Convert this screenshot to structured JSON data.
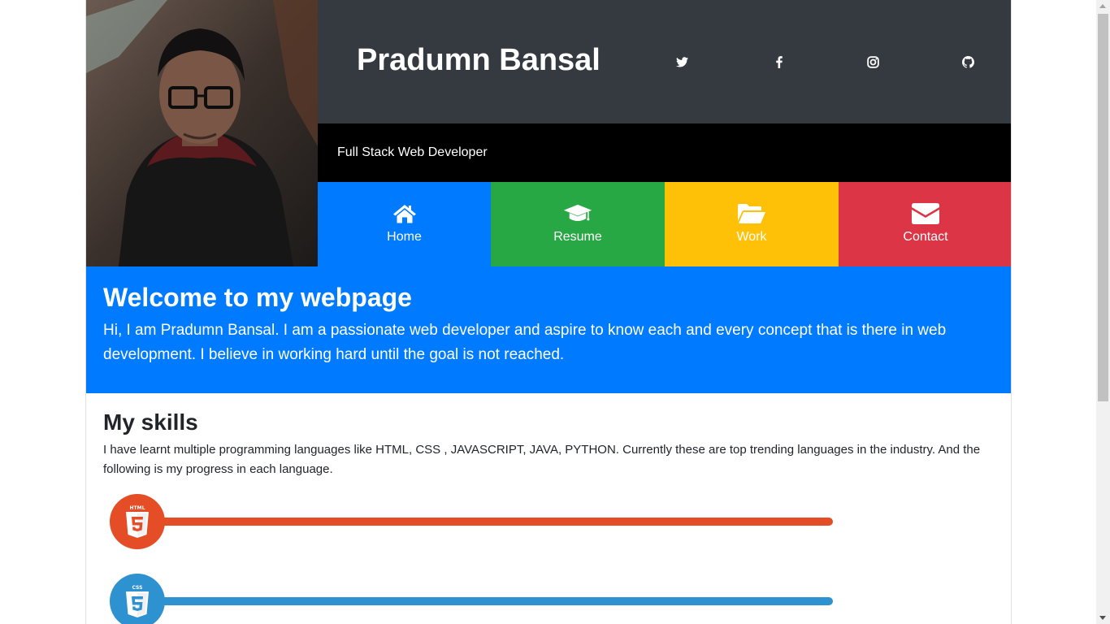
{
  "header": {
    "name": "Pradumn Bansal",
    "tagline": "Full Stack Web Developer",
    "photo_alt": "Profile photo of Pradumn Bansal",
    "social": [
      {
        "icon": "twitter-icon"
      },
      {
        "icon": "facebook-icon"
      },
      {
        "icon": "instagram-icon"
      },
      {
        "icon": "github-icon"
      }
    ],
    "colors": {
      "name_bar": "#343a40",
      "tagline_bar": "#000000"
    }
  },
  "nav": {
    "items": [
      {
        "label": "Home",
        "icon": "home-icon",
        "color": "#007bff"
      },
      {
        "label": "Resume",
        "icon": "graduation-cap-icon",
        "color": "#28a745"
      },
      {
        "label": "Work",
        "icon": "folder-open-icon",
        "color": "#ffc107"
      },
      {
        "label": "Contact",
        "icon": "envelope-icon",
        "color": "#dc3545"
      }
    ]
  },
  "welcome": {
    "title": "Welcome to my webpage",
    "text": "Hi, I am Pradumn Bansal. I am a passionate web developer and aspire to know each and every concept that is there in web development. I believe in working hard until the goal is not reached.",
    "color": "#007bff"
  },
  "skills": {
    "title": "My skills",
    "text": "I have learnt multiple programming languages like HTML, CSS , JAVASCRIPT, JAVA, PYTHON. Currently these are top trending languages in the industry. And the following is my progress in each language.",
    "items": [
      {
        "icon": "html5-icon",
        "badge_text": "HTML",
        "color": "#e44d26",
        "progress": 1.0
      },
      {
        "icon": "css3-icon",
        "badge_text": "CSS",
        "color": "#2f92d0",
        "progress": 1.0
      }
    ]
  }
}
